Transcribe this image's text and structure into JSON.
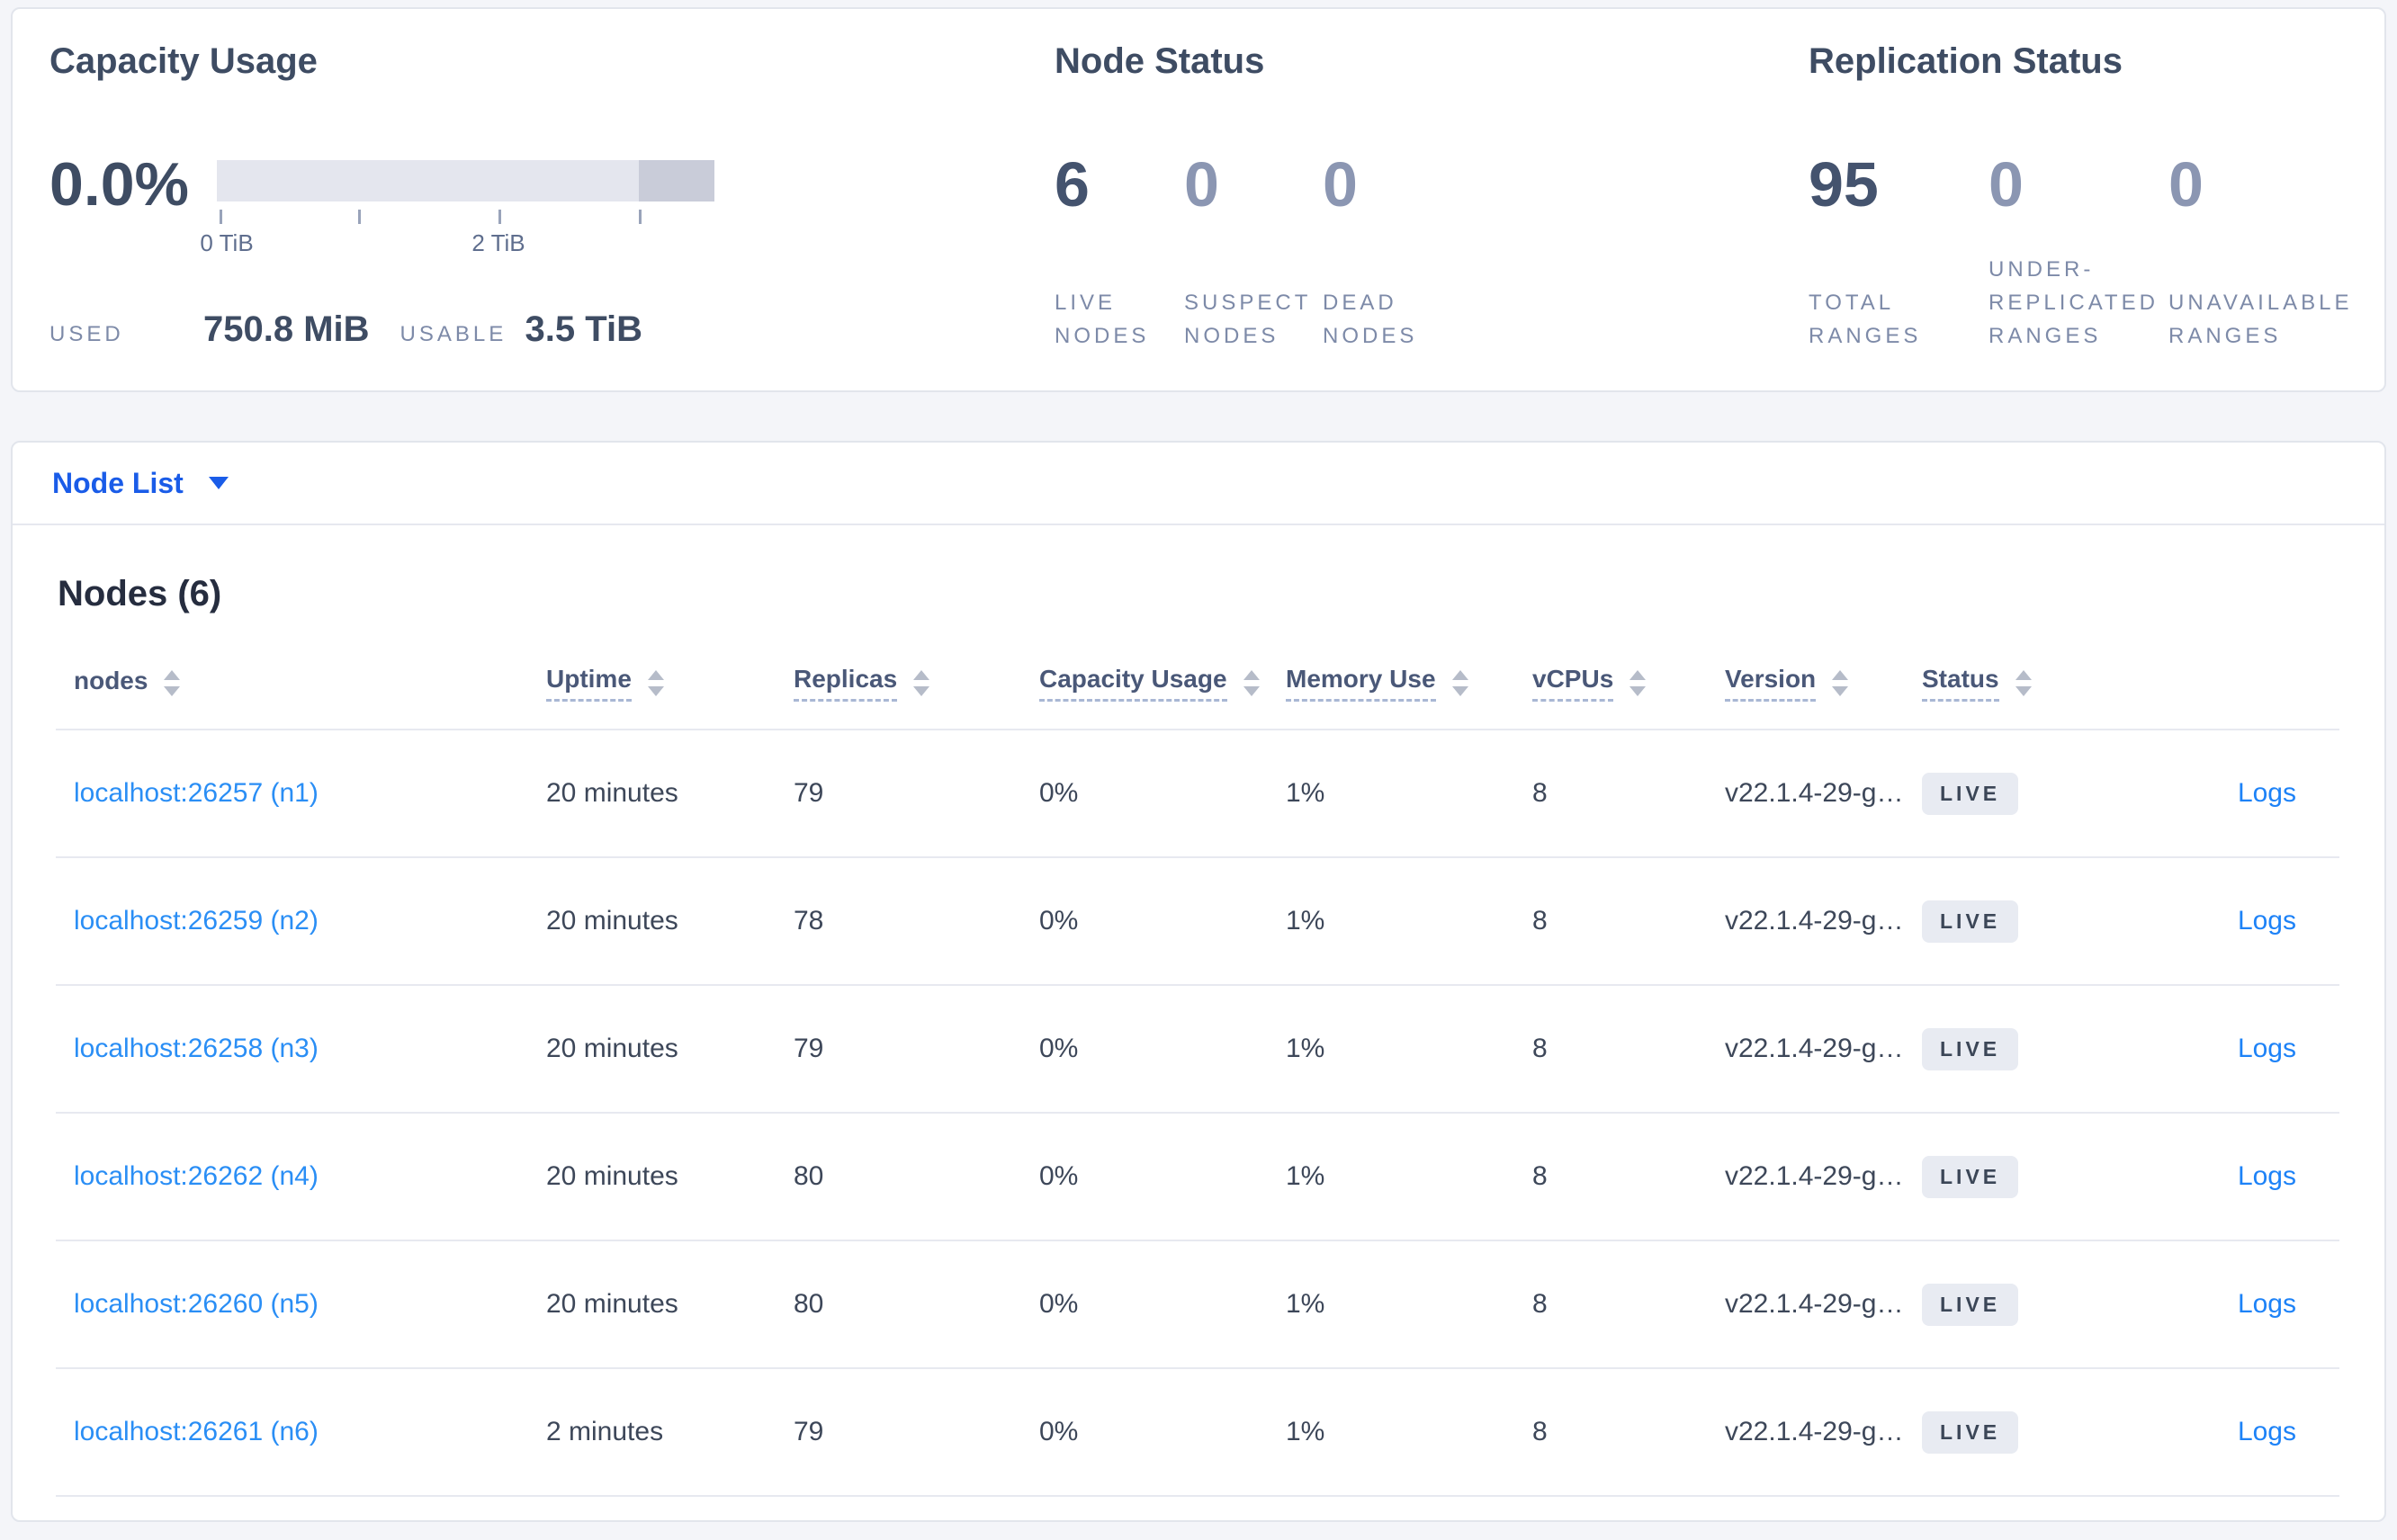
{
  "capacity": {
    "title": "Capacity Usage",
    "percent": "0.0%",
    "tick_label_0": "0 TiB",
    "tick_label_2": "2 TiB",
    "used_label": "USED",
    "used_value": "750.8 MiB",
    "usable_label": "USABLE",
    "usable_value": "3.5 TiB",
    "bar_colors": {
      "light": "#e4e6ee",
      "dark": "#c9ccd9"
    }
  },
  "node_status": {
    "title": "Node Status",
    "stats": [
      {
        "value": "6",
        "label_lines": [
          "LIVE",
          "NODES"
        ]
      },
      {
        "value": "0",
        "label_lines": [
          "SUSPECT",
          "NODES"
        ]
      },
      {
        "value": "0",
        "label_lines": [
          "DEAD",
          "NODES"
        ]
      }
    ]
  },
  "replication_status": {
    "title": "Replication Status",
    "stats": [
      {
        "value": "95",
        "label_lines": [
          "TOTAL",
          "RANGES"
        ]
      },
      {
        "value": "0",
        "label_lines": [
          "UNDER-",
          "REPLICATED",
          "RANGES"
        ]
      },
      {
        "value": "0",
        "label_lines": [
          "UNAVAILABLE",
          "RANGES"
        ]
      }
    ]
  },
  "node_list": {
    "dropdown_label": "Node List"
  },
  "nodes_section": {
    "heading": "Nodes (6)",
    "columns": [
      {
        "label": "nodes"
      },
      {
        "label": "Uptime"
      },
      {
        "label": "Replicas"
      },
      {
        "label": "Capacity Usage"
      },
      {
        "label": "Memory Use"
      },
      {
        "label": "vCPUs"
      },
      {
        "label": "Version"
      },
      {
        "label": "Status"
      }
    ],
    "rows": [
      {
        "node": "localhost:26257 (n1)",
        "uptime": "20 minutes",
        "replicas": "79",
        "capacity": "0%",
        "memory": "1%",
        "vcpus": "8",
        "version": "v22.1.4-29-g…",
        "status": "LIVE",
        "logs": "Logs"
      },
      {
        "node": "localhost:26259 (n2)",
        "uptime": "20 minutes",
        "replicas": "78",
        "capacity": "0%",
        "memory": "1%",
        "vcpus": "8",
        "version": "v22.1.4-29-g…",
        "status": "LIVE",
        "logs": "Logs"
      },
      {
        "node": "localhost:26258 (n3)",
        "uptime": "20 minutes",
        "replicas": "79",
        "capacity": "0%",
        "memory": "1%",
        "vcpus": "8",
        "version": "v22.1.4-29-g…",
        "status": "LIVE",
        "logs": "Logs"
      },
      {
        "node": "localhost:26262 (n4)",
        "uptime": "20 minutes",
        "replicas": "80",
        "capacity": "0%",
        "memory": "1%",
        "vcpus": "8",
        "version": "v22.1.4-29-g…",
        "status": "LIVE",
        "logs": "Logs"
      },
      {
        "node": "localhost:26260 (n5)",
        "uptime": "20 minutes",
        "replicas": "80",
        "capacity": "0%",
        "memory": "1%",
        "vcpus": "8",
        "version": "v22.1.4-29-g…",
        "status": "LIVE",
        "logs": "Logs"
      },
      {
        "node": "localhost:26261 (n6)",
        "uptime": "2 minutes",
        "replicas": "79",
        "capacity": "0%",
        "memory": "1%",
        "vcpus": "8",
        "version": "v22.1.4-29-g…",
        "status": "LIVE",
        "logs": "Logs"
      }
    ]
  }
}
